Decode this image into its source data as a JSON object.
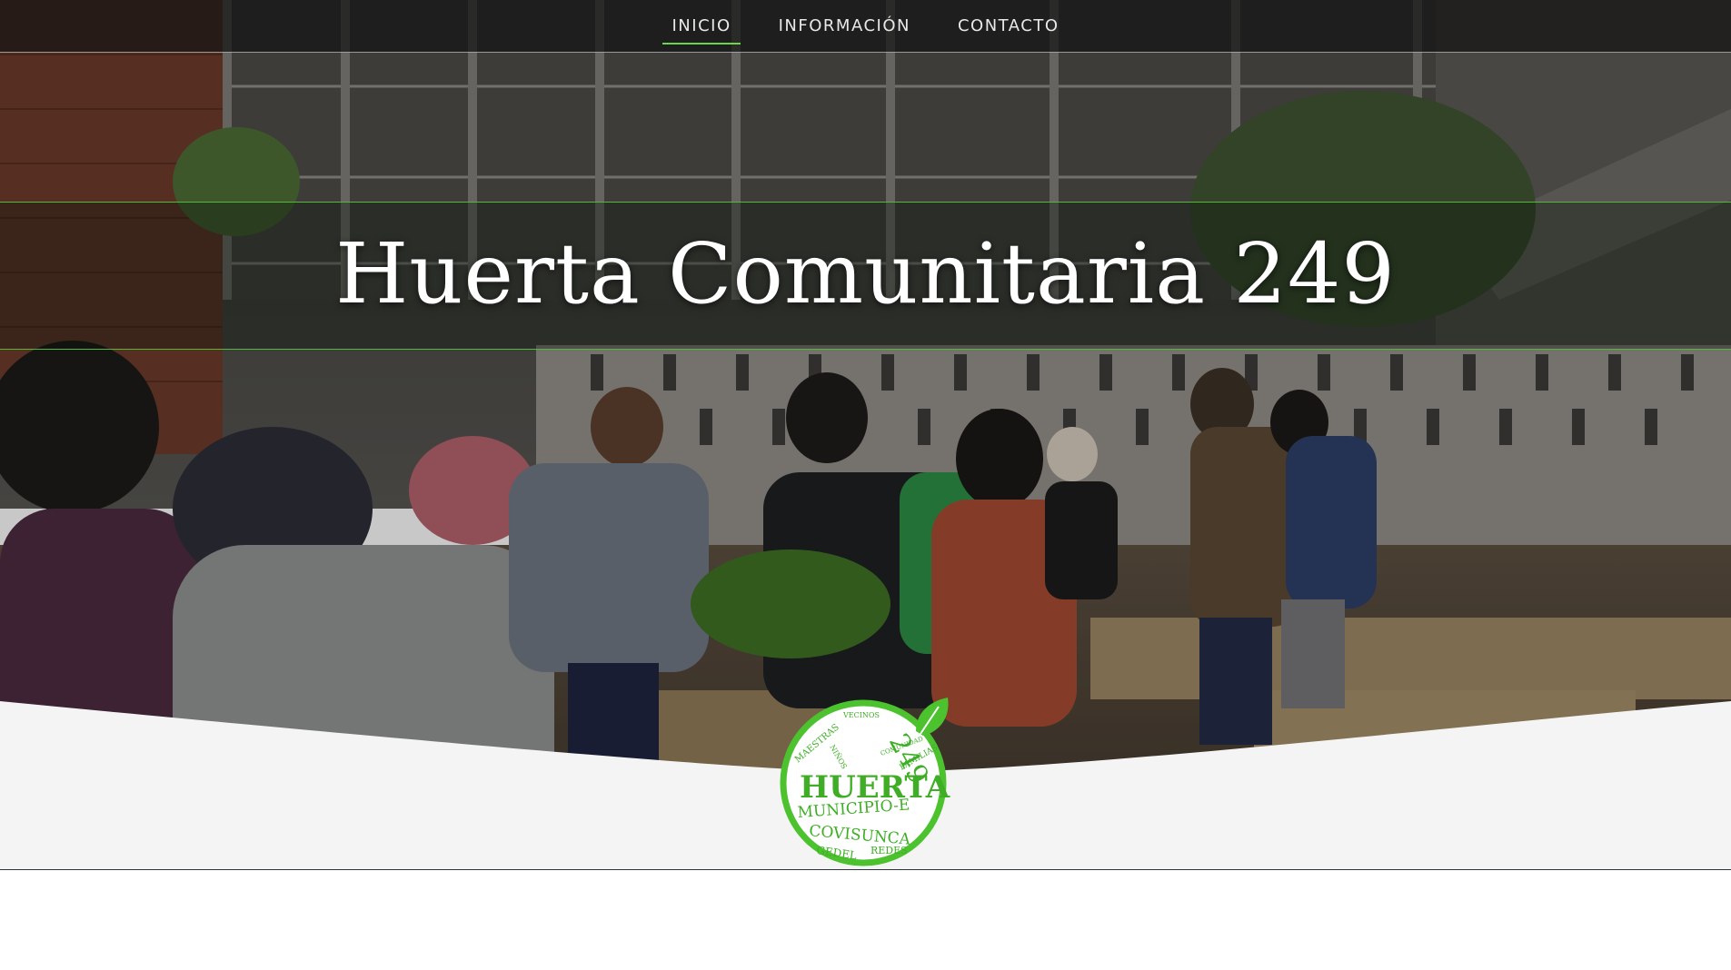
{
  "nav": {
    "items": [
      {
        "label": "INICIO",
        "active": true
      },
      {
        "label": "INFORMACIÓN",
        "active": false
      },
      {
        "label": "CONTACTO",
        "active": false
      }
    ]
  },
  "hero": {
    "title": "Huerta Comunitaria 249"
  },
  "logo": {
    "number": "249",
    "word_main": "HUERTA",
    "word_line2": "MUNICIPIO-E",
    "word_line3": "COVISUNCA",
    "word_line4": "GEDEL",
    "word_line5": "REDES",
    "word_small_1": "MAESTRAS",
    "word_small_2": "FAMILIAS",
    "word_small_3": "VECINOS",
    "word_small_4": "NIÑOS",
    "word_small_5": "COMUNIDAD"
  },
  "colors": {
    "accent_green": "#56b83a",
    "logo_green": "#3fae26",
    "wave_gray": "#f4f4f4",
    "nav_bg": "#141414"
  }
}
